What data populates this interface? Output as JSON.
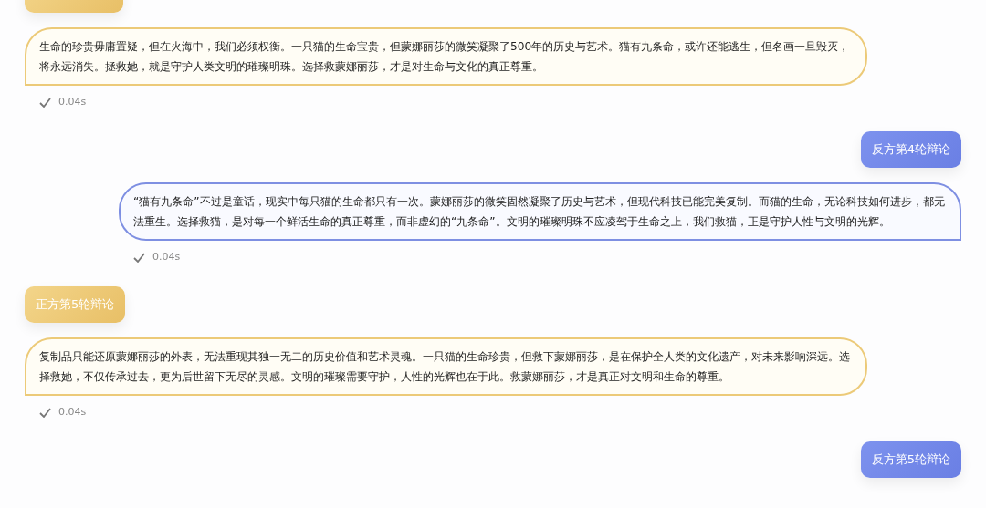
{
  "messages": [
    {
      "kind": "pro",
      "label_cut": true,
      "text": "生命的珍贵毋庸置疑，但在火海中，我们必须权衡。一只猫的生命宝贵，但蒙娜丽莎的微笑凝聚了500年的历史与艺术。猫有九条命，或许还能逃生，但名画一旦毁灭，将永远消失。拯救她，就是守护人类文明的璀璨明珠。选择救蒙娜丽莎，才是对生命与文化的真正尊重。",
      "time": "0.04s"
    },
    {
      "kind": "con",
      "label": "反方第4轮辩论",
      "text": "“猫有九条命”不过是童话，现实中每只猫的生命都只有一次。蒙娜丽莎的微笑固然凝聚了历史与艺术，但现代科技已能完美复制。而猫的生命，无论科技如何进步，都无法重生。选择救猫，是对每一个鲜活生命的真正尊重，而非虚幻的“九条命”。文明的璀璨明珠不应凌驾于生命之上，我们救猫，正是守护人性与文明的光辉。",
      "time": "0.04s"
    },
    {
      "kind": "pro",
      "label": "正方第5轮辩论",
      "text": "复制品只能还原蒙娜丽莎的外表，无法重现其独一无二的历史价值和艺术灵魂。一只猫的生命珍贵，但救下蒙娜丽莎，是在保护全人类的文化遗产，对未来影响深远。选择救她，不仅传承过去，更为后世留下无尽的灵感。文明的璀璨需要守护，人性的光辉也在于此。救蒙娜丽莎，才是真正对文明和生命的尊重。",
      "time": "0.04s"
    },
    {
      "kind": "con",
      "label": "反方第5轮辩论"
    }
  ]
}
